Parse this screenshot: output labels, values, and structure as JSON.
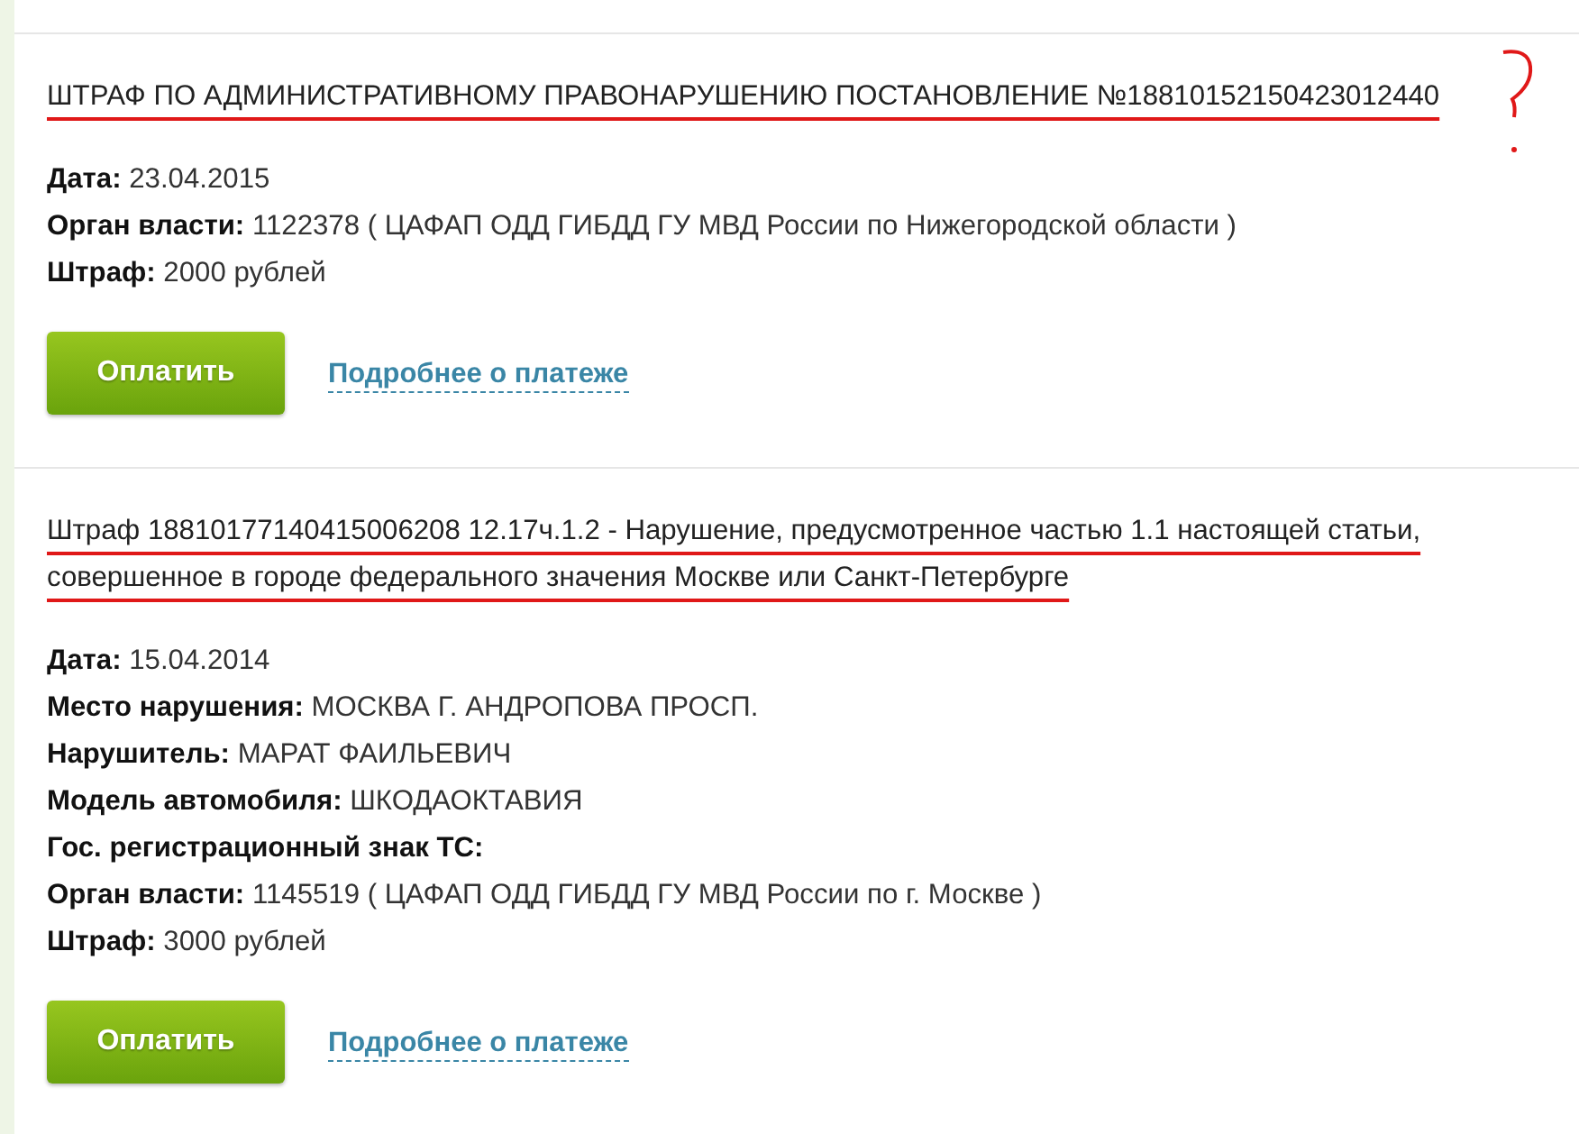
{
  "fines": [
    {
      "title": "ШТРАФ ПО АДМИНИСТРАТИВНОМУ ПРАВОНАРУШЕНИЮ ПОСТАНОВЛЕНИЕ №18810152150423012440",
      "underlined": true,
      "question_mark": true,
      "fields": [
        {
          "label": "Дата:",
          "value": "23.04.2015"
        },
        {
          "label": "Орган власти:",
          "value": "1122378 ( ЦАФАП ОДД ГИБДД ГУ МВД России по Нижегородской области )"
        },
        {
          "label": "Штраф:",
          "value": "2000 рублей"
        }
      ],
      "pay_button": "Оплатить",
      "details_link": "Подробнее о платеже"
    },
    {
      "title": "Штраф 18810177140415006208 12.17ч.1.2 - Нарушение, предусмотренное частью 1.1 настоящей статьи, совершенное в городе федерального значения Москве или Санкт-Петербурге",
      "underlined": true,
      "fields": [
        {
          "label": "Дата:",
          "value": "15.04.2014"
        },
        {
          "label": "Место нарушения:",
          "value": "МОСКВА Г. АНДРОПОВА ПРОСП."
        },
        {
          "label": "Нарушитель:",
          "value": "МАРАТ ФАИЛЬЕВИЧ"
        },
        {
          "label": "Модель автомобиля:",
          "value": "ШКОДАОКТАВИЯ"
        },
        {
          "label": "Гос. регистрационный знак ТС:"
        },
        {
          "label": "Орган власти:",
          "value": "1145519 ( ЦАФАП ОДД ГИБДД ГУ МВД России по г. Москве )"
        },
        {
          "label": "Штраф:",
          "value": "3000 рублей"
        }
      ],
      "pay_button": "Оплатить",
      "details_link": "Подробнее о платеже"
    }
  ]
}
